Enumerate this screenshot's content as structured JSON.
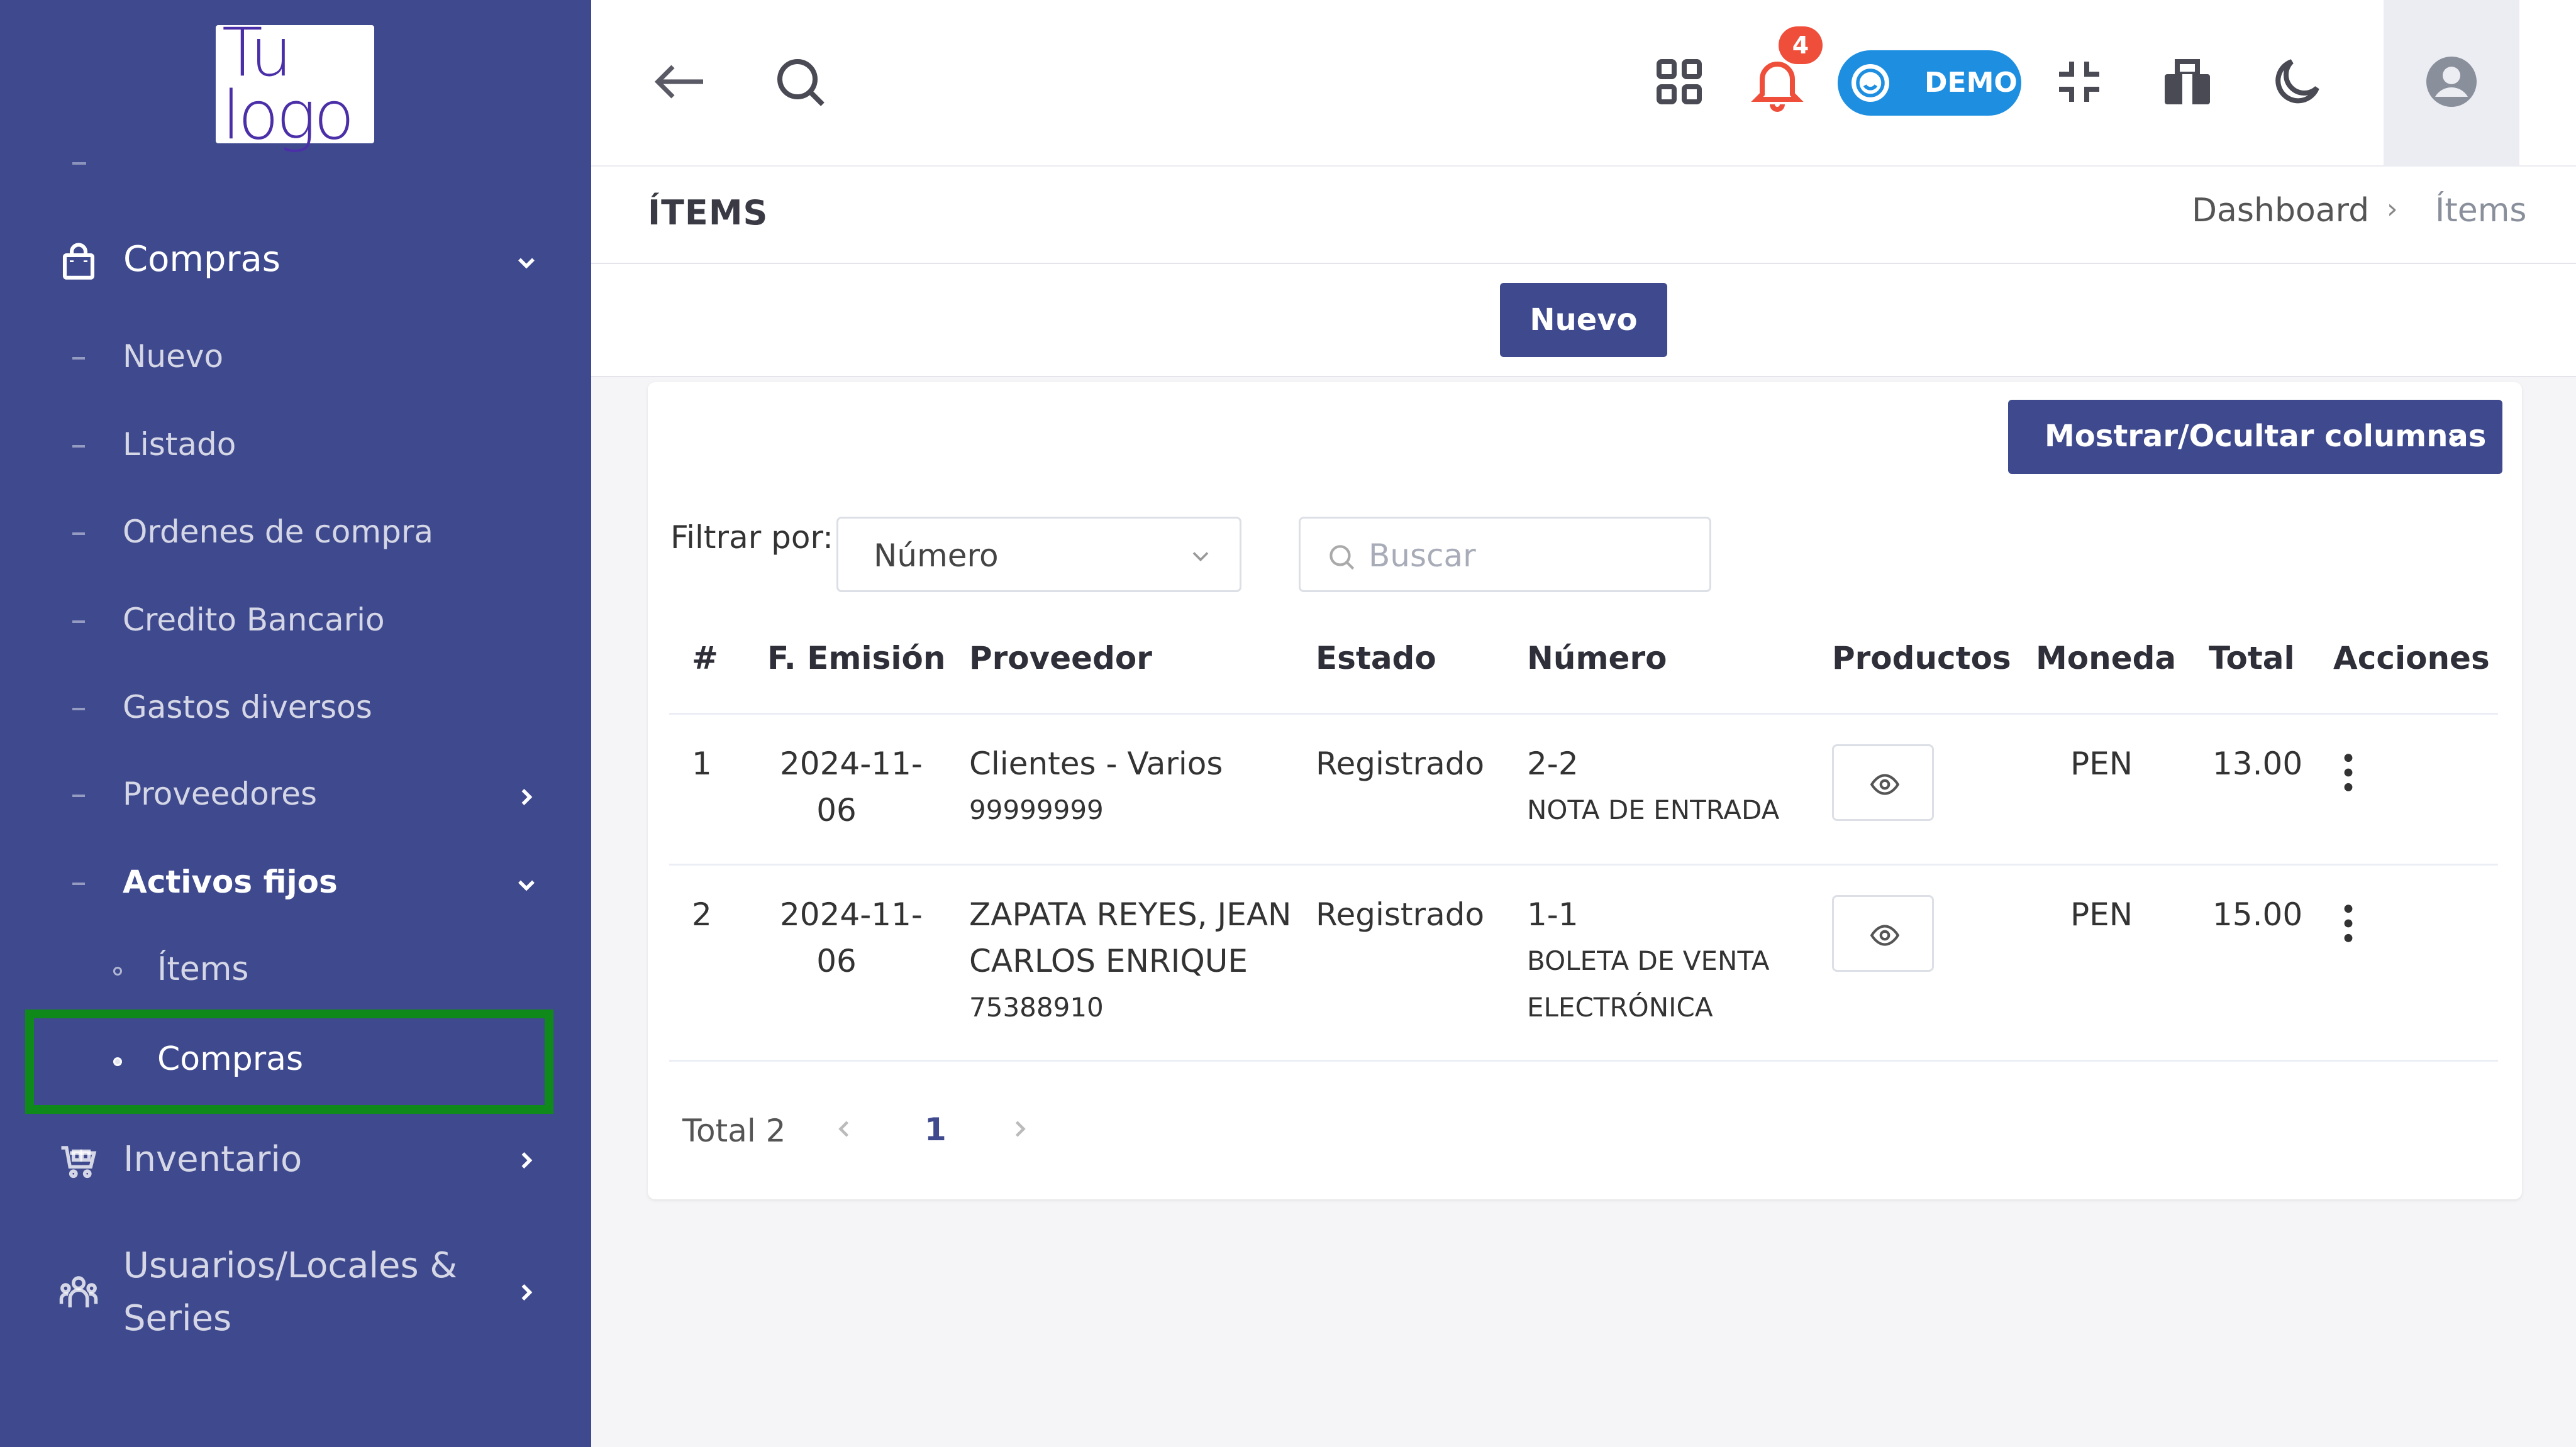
{
  "sidebar": {
    "logo_text_line1": "Tu",
    "logo_text_line2": "logo",
    "compras_label": "Compras",
    "sub_items": [
      "Nuevo",
      "Listado",
      "Ordenes de compra",
      "Credito Bancario",
      "Gastos diversos",
      "Proveedores",
      "Activos fijos"
    ],
    "activos_children": [
      "Ítems",
      "Compras"
    ],
    "inventario_label": "Inventario",
    "usuarios_label_line1": "Usuarios/Locales &",
    "usuarios_label_line2": "Series"
  },
  "topbar": {
    "notification_count": "4",
    "demo_label": "DEMO"
  },
  "page": {
    "title": "ÍTEMS",
    "breadcrumb_home": "Dashboard",
    "breadcrumb_sep": "›",
    "breadcrumb_current": "Ítems",
    "new_button": "Nuevo",
    "columns_button": "Mostrar/Ocultar columnas"
  },
  "filter": {
    "label": "Filtrar por:",
    "selected": "Número",
    "search_placeholder": "Buscar"
  },
  "table": {
    "headers": [
      "#",
      "F. Emisión",
      "Proveedor",
      "Estado",
      "Número",
      "Productos",
      "Moneda",
      "Total",
      "Acciones"
    ],
    "rows": [
      {
        "index": "1",
        "date_line1": "2024-11-",
        "date_line2": "06",
        "provider_line1": "Clientes - Varios",
        "provider_line2": "",
        "provider_doc": "99999999",
        "status": "Registrado",
        "number": "2-2",
        "doc_type_line1": "NOTA DE ENTRADA",
        "doc_type_line2": "",
        "currency": "PEN",
        "total": "13.00"
      },
      {
        "index": "2",
        "date_line1": "2024-11-",
        "date_line2": "06",
        "provider_line1": "ZAPATA REYES, JEAN",
        "provider_line2": "CARLOS ENRIQUE",
        "provider_doc": "75388910",
        "status": "Registrado",
        "number": "1-1",
        "doc_type_line1": "BOLETA DE VENTA",
        "doc_type_line2": "ELECTRÓNICA",
        "currency": "PEN",
        "total": "15.00"
      }
    ]
  },
  "pagination": {
    "total_label": "Total 2",
    "current_page": "1"
  },
  "colors": {
    "sidebar_bg": "#3f4a8e",
    "primary": "#3f4a8e",
    "demo_pill": "#1e8fe0",
    "badge": "#ef4e3a",
    "highlight": "#0f8a1a"
  }
}
